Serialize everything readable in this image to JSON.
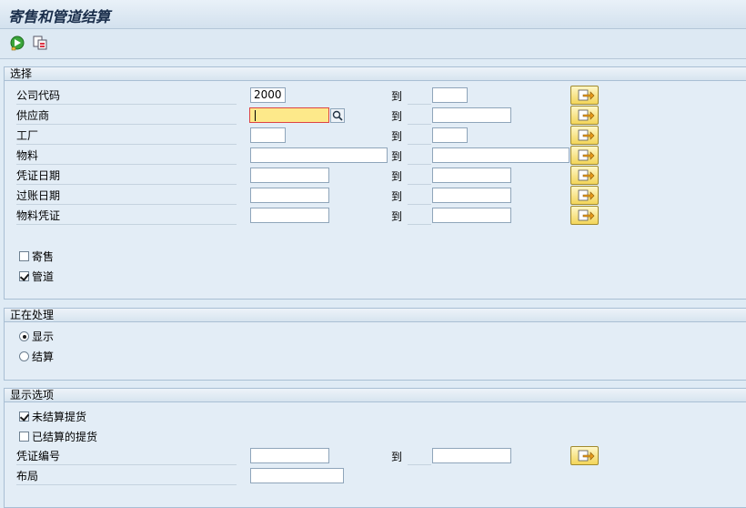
{
  "window": {
    "title": "寄售和管道结算"
  },
  "toolbar": {
    "execute_icon": "execute-icon",
    "variant_icon": "get-variant-icon"
  },
  "selection": {
    "header": "选择",
    "to_label": "到",
    "company_code": {
      "label": "公司代码",
      "from": "2000",
      "to": ""
    },
    "vendor": {
      "label": "供应商",
      "from": "",
      "to": ""
    },
    "plant": {
      "label": "工厂",
      "from": "",
      "to": ""
    },
    "material": {
      "label": "物料",
      "from": "",
      "to": ""
    },
    "doc_date": {
      "label": "凭证日期",
      "from": "",
      "to": ""
    },
    "posting_date": {
      "label": "过账日期",
      "from": "",
      "to": ""
    },
    "material_doc": {
      "label": "物料凭证",
      "from": "",
      "to": ""
    },
    "consignment": {
      "label": "寄售",
      "checked": false
    },
    "pipeline": {
      "label": "管道",
      "checked": true
    }
  },
  "processing": {
    "header": "正在处理",
    "display": {
      "label": "显示",
      "selected": true
    },
    "settle": {
      "label": "结算",
      "selected": false
    }
  },
  "display_options": {
    "header": "显示选项",
    "unsettled": {
      "label": "未结算提货",
      "checked": true
    },
    "settled": {
      "label": "已结算的提货",
      "checked": false
    },
    "doc_number": {
      "label": "凭证编号",
      "from": "",
      "to": ""
    },
    "layout": {
      "label": "布局",
      "value": ""
    },
    "to_label": "到"
  }
}
